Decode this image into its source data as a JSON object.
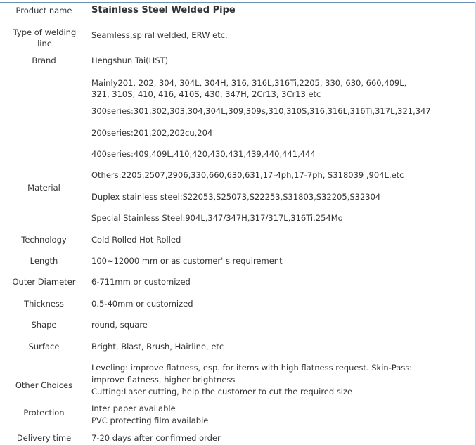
{
  "rows": [
    {
      "label": "Product name",
      "lines": [
        "Stainless Steel Welded Pipe"
      ]
    },
    {
      "label": "Type of welding line",
      "lines": [
        "Seamless,spiral welded, ERW etc."
      ]
    },
    {
      "label": "Brand",
      "lines": [
        "Hengshun Tai(HST)"
      ]
    },
    {
      "label": "Material",
      "lines": [
        "Mainly201, 202, 304, 304L, 304H, 316, 316L,316Ti,2205, 330, 630, 660,409L, 321, 310S, 410, 416, 410S, 430, 347H, 2Cr13, 3Cr13 etc",
        "300series:301,302,303,304,304L,309,309s,310,310S,316,316L,316Ti,317L,321,347",
        "200series:201,202,202cu,204",
        "400series:409,409L,410,420,430,431,439,440,441,444",
        "Others:2205,2507,2906,330,660,630,631,17-4ph,17-7ph, S318039 ,904L,etc",
        "Duplex stainless steel:S22053,S25073,S22253,S31803,S32205,S32304",
        "Special Stainless Steel:904L,347/347H,317/317L,316Ti,254Mo"
      ]
    },
    {
      "label": "Technology",
      "lines": [
        "Cold Rolled Hot Rolled"
      ]
    },
    {
      "label": "Length",
      "lines": [
        "100~12000 mm or as customer' s requirement"
      ]
    },
    {
      "label": "Outer Diameter",
      "lines": [
        "6-711mm or customized"
      ]
    },
    {
      "label": "Thickness",
      "lines": [
        "0.5-40mm or customized"
      ]
    },
    {
      "label": "Shape",
      "lines": [
        "round, square"
      ]
    },
    {
      "label": "Surface",
      "lines": [
        "Bright, Blast, Brush, Hairline, etc"
      ]
    },
    {
      "label": "Other Choices",
      "lines": [
        "Leveling: improve flatness, esp. for items with high flatness request. Skin-Pass: improve flatness, higher brightness",
        "Cutting:Laser cutting, help the customer to cut the required size"
      ]
    },
    {
      "label": "Protection",
      "lines": [
        "Inter paper available",
        "PVC protecting film available"
      ]
    },
    {
      "label": "Delivery time",
      "lines": [
        "7-20 days after confirmed order"
      ]
    }
  ]
}
